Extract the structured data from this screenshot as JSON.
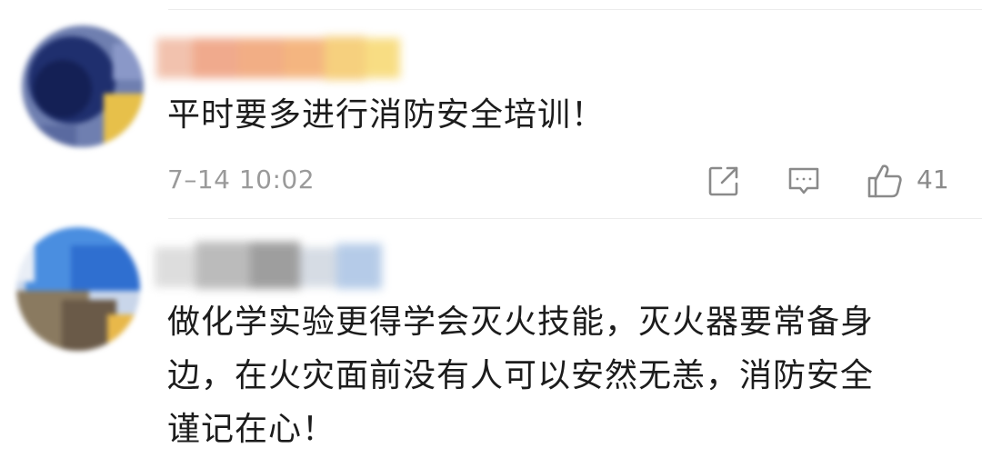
{
  "comments": [
    {
      "text": "平时要多进行消防安全培训！",
      "timestamp": "7–14 10:02",
      "like_count": "41",
      "icons": {
        "share": "share-icon",
        "reply": "comment-icon",
        "like": "thumbs-up-icon"
      }
    },
    {
      "text_lines": [
        "做化学实验更得学会灭火技能，灭火器要常备身",
        "边，在火灾面前没有人可以安然无恙，消防安全",
        "谨记在心！"
      ]
    }
  ],
  "colors": {
    "text": "#1c1c1c",
    "meta": "#9a9a9a",
    "divider": "#ececec"
  }
}
